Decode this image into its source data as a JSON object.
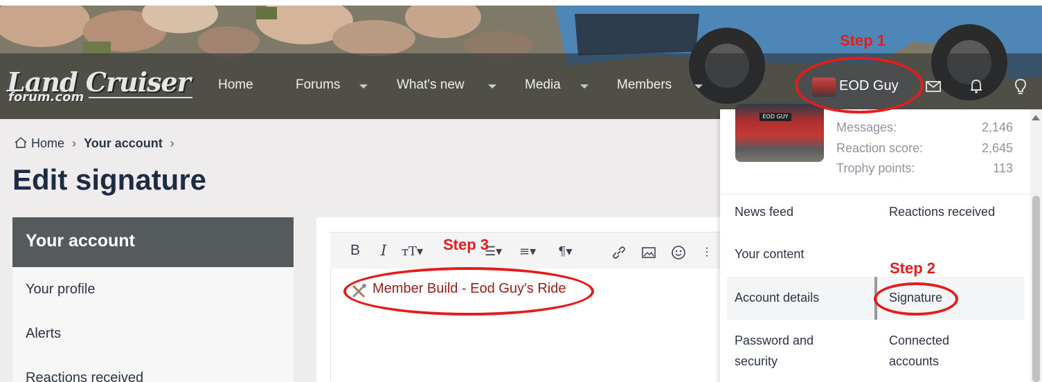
{
  "header": {
    "logo_main": "Land Cruiser",
    "logo_sub": "forum.com",
    "nav": [
      {
        "label": "Home",
        "has_menu": false
      },
      {
        "label": "Forums",
        "has_menu": true
      },
      {
        "label": "What's new",
        "has_menu": true
      },
      {
        "label": "Media",
        "has_menu": true
      },
      {
        "label": "Members",
        "has_menu": true
      }
    ],
    "user_name": "EOD Guy",
    "icons": [
      "mail-icon",
      "bell-icon",
      "lightbulb-icon"
    ]
  },
  "breadcrumb": {
    "items": [
      "Home",
      "Your account"
    ],
    "separator": "›"
  },
  "page_title": "Edit signature",
  "sidebar": {
    "heading": "Your account",
    "items": [
      "Your profile",
      "Alerts",
      "Reactions received"
    ]
  },
  "editor": {
    "toolbar": [
      "bold",
      "italic",
      "text-size",
      "list",
      "align",
      "paragraph",
      "link",
      "image",
      "smilie",
      "more"
    ],
    "signature_text": "Member Build - Eod Guy's Ride"
  },
  "dropdown": {
    "plate_text": "EOD GUY",
    "stats": [
      {
        "label": "Messages:",
        "value": "2,146"
      },
      {
        "label": "Reaction score:",
        "value": "2,645"
      },
      {
        "label": "Trophy points:",
        "value": "113"
      }
    ],
    "links": [
      {
        "label": "News feed"
      },
      {
        "label": "Reactions received"
      },
      {
        "label": "Your content"
      },
      {
        "label": "Account details"
      },
      {
        "label": "Signature"
      },
      {
        "label": "Password and security"
      },
      {
        "label": "Connected accounts"
      }
    ]
  },
  "annotations": {
    "step1": "Step 1",
    "step2": "Step 2",
    "step3": "Step 3",
    "color": "#e41c1c"
  }
}
